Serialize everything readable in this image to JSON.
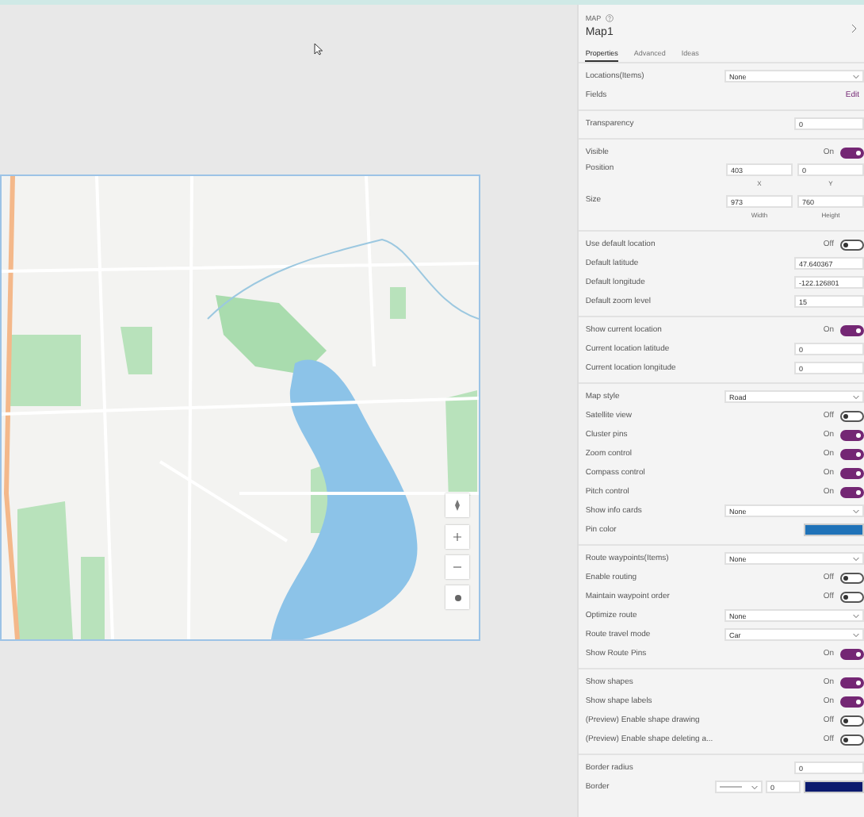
{
  "panel": {
    "control_type": "MAP",
    "name": "Map1",
    "tabs": [
      {
        "label": "Properties",
        "selected": true
      },
      {
        "label": "Advanced",
        "selected": false
      },
      {
        "label": "Ideas",
        "selected": false
      }
    ],
    "sections": [
      {
        "rows": [
          {
            "kind": "dropdown",
            "label": "Locations(Items)",
            "value": "None"
          },
          {
            "kind": "link",
            "label": "Fields",
            "value": "Edit"
          }
        ]
      },
      {
        "rows": [
          {
            "kind": "input",
            "label": "Transparency",
            "value": "0"
          }
        ]
      },
      {
        "rows": [
          {
            "kind": "toggle",
            "label": "Visible",
            "value": "On",
            "on": true
          },
          {
            "kind": "pair",
            "label": "Position",
            "values": [
              "403",
              "0"
            ],
            "captions": [
              "X",
              "Y"
            ]
          },
          {
            "kind": "pair",
            "label": "Size",
            "values": [
              "973",
              "760"
            ],
            "captions": [
              "Width",
              "Height"
            ]
          }
        ]
      },
      {
        "rows": [
          {
            "kind": "toggle",
            "label": "Use default location",
            "value": "Off",
            "on": false
          },
          {
            "kind": "input",
            "label": "Default latitude",
            "value": "47.640367"
          },
          {
            "kind": "input",
            "label": "Default longitude",
            "value": "-122.126801"
          },
          {
            "kind": "input",
            "label": "Default zoom level",
            "value": "15"
          }
        ]
      },
      {
        "rows": [
          {
            "kind": "toggle",
            "label": "Show current location",
            "value": "On",
            "on": true
          },
          {
            "kind": "input",
            "label": "Current location latitude",
            "value": "0"
          },
          {
            "kind": "input",
            "label": "Current location longitude",
            "value": "0"
          }
        ]
      },
      {
        "rows": [
          {
            "kind": "dropdown",
            "label": "Map style",
            "value": "Road"
          },
          {
            "kind": "toggle",
            "label": "Satellite view",
            "value": "Off",
            "on": false
          },
          {
            "kind": "toggle",
            "label": "Cluster pins",
            "value": "On",
            "on": true
          },
          {
            "kind": "toggle",
            "label": "Zoom control",
            "value": "On",
            "on": true
          },
          {
            "kind": "toggle",
            "label": "Compass control",
            "value": "On",
            "on": true
          },
          {
            "kind": "toggle",
            "label": "Pitch control",
            "value": "On",
            "on": true
          },
          {
            "kind": "dropdown",
            "label": "Show info cards",
            "value": "None"
          },
          {
            "kind": "color",
            "label": "Pin color",
            "color": "#1f72b8"
          }
        ]
      },
      {
        "rows": [
          {
            "kind": "dropdown",
            "label": "Route waypoints(Items)",
            "value": "None"
          },
          {
            "kind": "toggle",
            "label": "Enable routing",
            "value": "Off",
            "on": false
          },
          {
            "kind": "toggle",
            "label": "Maintain waypoint order",
            "value": "Off",
            "on": false
          },
          {
            "kind": "dropdown",
            "label": "Optimize route",
            "value": "None"
          },
          {
            "kind": "dropdown",
            "label": "Route travel mode",
            "value": "Car"
          },
          {
            "kind": "toggle",
            "label": "Show Route Pins",
            "value": "On",
            "on": true
          }
        ]
      },
      {
        "rows": [
          {
            "kind": "toggle",
            "label": "Show shapes",
            "value": "On",
            "on": true
          },
          {
            "kind": "toggle",
            "label": "Show shape labels",
            "value": "On",
            "on": true
          },
          {
            "kind": "toggle",
            "label": "(Preview) Enable shape drawing",
            "value": "Off",
            "on": false
          },
          {
            "kind": "toggle",
            "label": "(Preview) Enable shape deleting a...",
            "value": "Off",
            "on": false
          }
        ]
      },
      {
        "rows": [
          {
            "kind": "input",
            "label": "Border radius",
            "value": "0"
          },
          {
            "kind": "border",
            "label": "Border",
            "value": "0",
            "color": "#0b1a6e"
          }
        ]
      }
    ]
  }
}
